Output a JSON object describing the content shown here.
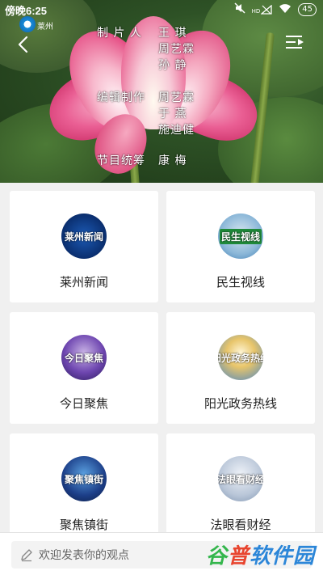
{
  "status_bar": {
    "time": "傍晚6:25",
    "battery": "45",
    "signal_label": "HD"
  },
  "video": {
    "channel_logo_text": "莱州",
    "credits": [
      {
        "role": "制 片 人",
        "names": [
          "王 琪",
          "周艺霖",
          "孙 静"
        ]
      },
      {
        "role": "编辑制作",
        "names": [
          "周艺霖",
          "于 燕",
          "施迪健"
        ]
      },
      {
        "role": "节目统筹",
        "names": [
          "康 梅"
        ]
      }
    ]
  },
  "programs": [
    {
      "label": "莱州新闻",
      "icon": "laizhou-news-icon",
      "icon_text": "莱州新闻"
    },
    {
      "label": "民生视线",
      "icon": "minsheng-icon",
      "icon_text": "民生视线"
    },
    {
      "label": "今日聚焦",
      "icon": "jinri-jujiao-icon",
      "icon_text": "今日聚焦"
    },
    {
      "label": "阳光政务热线",
      "icon": "yangguang-icon",
      "icon_text": "阳光政务热线"
    },
    {
      "label": "聚焦镇街",
      "icon": "jujiao-zhenjie-icon",
      "icon_text": "聚焦镇街"
    },
    {
      "label": "法眼看财经",
      "icon": "fayan-icon",
      "icon_text": "法眼看财经"
    }
  ],
  "comment_bar": {
    "placeholder": "欢迎发表你的观点"
  },
  "watermark": {
    "a": "谷",
    "b": "普",
    "c": "软件园"
  },
  "colors": {
    "background": "#f0f0f0",
    "card": "#ffffff",
    "text": "#222222"
  }
}
